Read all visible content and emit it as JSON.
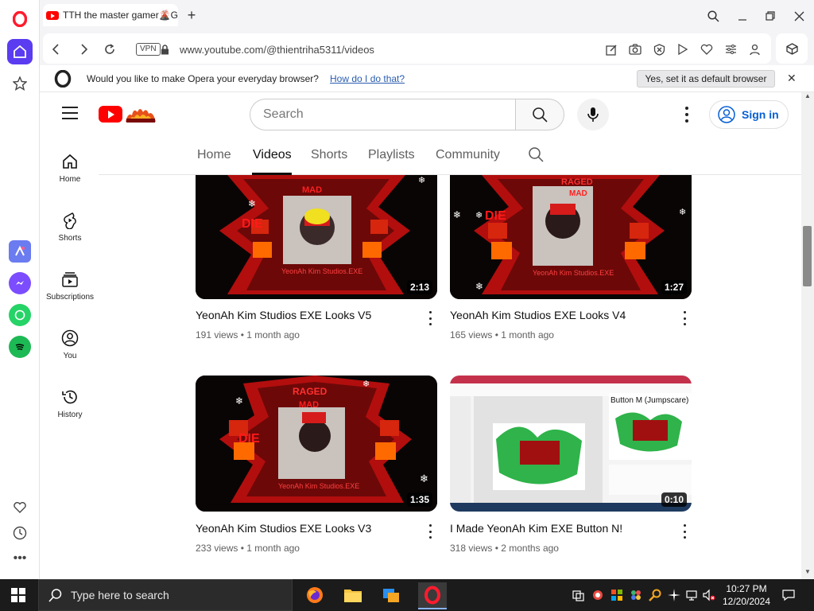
{
  "browser": {
    "tab_title": "TTH the master gamer🌋G",
    "url": "www.youtube.com/@thientriha5311/videos",
    "vpn_label": "VPN",
    "infobar": {
      "message": "Would you like to make Opera your everyday browser?",
      "link": "How do I do that?",
      "button": "Yes, set it as default browser"
    }
  },
  "youtube": {
    "search_placeholder": "Search",
    "sign_in": "Sign in",
    "sidebar": [
      {
        "label": "Home",
        "icon": "home-icon"
      },
      {
        "label": "Shorts",
        "icon": "shorts-icon"
      },
      {
        "label": "Subscriptions",
        "icon": "subscriptions-icon"
      },
      {
        "label": "You",
        "icon": "you-icon"
      },
      {
        "label": "History",
        "icon": "history-icon"
      }
    ],
    "tabs": [
      "Home",
      "Videos",
      "Shorts",
      "Playlists",
      "Community"
    ],
    "active_tab": "Videos",
    "videos": [
      {
        "title": "YeonAh Kim Studios EXE Looks V5",
        "views": "191 views",
        "age": "1 month ago",
        "duration": "2:13"
      },
      {
        "title": "YeonAh Kim Studios EXE Looks V4",
        "views": "165 views",
        "age": "1 month ago",
        "duration": "1:27"
      },
      {
        "title": "YeonAh Kim Studios EXE Looks V3",
        "views": "233 views",
        "age": "1 month ago",
        "duration": "1:35"
      },
      {
        "title": "I Made YeonAh Kim EXE Button N!",
        "views": "318 views",
        "age": "2 months ago",
        "duration": "0:10"
      }
    ],
    "thumb_text": {
      "mad": "MAD",
      "rage": "RAGED",
      "die": "DIE",
      "watermark": "YeonAh Kim Studios.EXE",
      "button_label": "Button M (Jumpscare)"
    }
  },
  "taskbar": {
    "search_placeholder": "Type here to search",
    "time": "10:27 PM",
    "date": "12/20/2024"
  },
  "colors": {
    "youtube_red": "#ff0000",
    "link_blue": "#065fd4",
    "opera_red": "#ff1b2d",
    "opera_home_purple": "#5b3cf0"
  }
}
